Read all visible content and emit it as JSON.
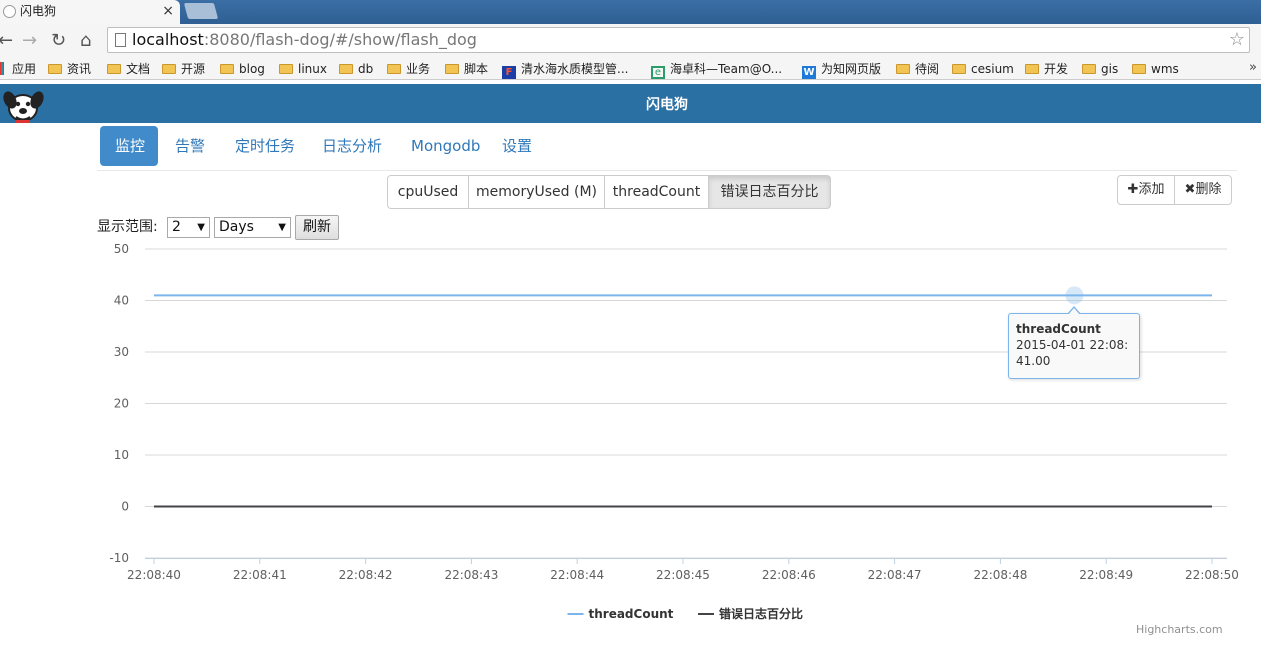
{
  "browser": {
    "tab_title": "闪电狗",
    "tab_close": "×",
    "url_host": "localhost",
    "url_rest": ":8080/flash-dog/#/show/flash_dog",
    "bookmarks": [
      "应用",
      "资讯",
      "文档",
      "开源",
      "blog",
      "linux",
      "db",
      "业务",
      "脚本",
      "清水海水质模型管...",
      "海卓科—Team@O...",
      "为知网页版",
      "待阅",
      "cesium",
      "开发",
      "gis",
      "wms"
    ],
    "more": "»"
  },
  "app": {
    "title": "闪电狗"
  },
  "nav": {
    "tabs": [
      "监控",
      "告警",
      "定时任务",
      "日志分析",
      "Mongodb",
      "设置"
    ],
    "active": "监控"
  },
  "metrics": {
    "buttons": [
      "cpuUsed",
      "memoryUsed (M)",
      "threadCount",
      "错误日志百分比"
    ],
    "active": "错误日志百分比",
    "add_label": "添加",
    "delete_label": "删除"
  },
  "range": {
    "label": "显示范围:",
    "count": "2",
    "unit": "Days",
    "refresh_label": "刷新"
  },
  "chart_data": {
    "type": "line",
    "x": [
      "22:08:40",
      "22:08:41",
      "22:08:42",
      "22:08:43",
      "22:08:44",
      "22:08:45",
      "22:08:46",
      "22:08:47",
      "22:08:48",
      "22:08:49",
      "22:08:50"
    ],
    "series": [
      {
        "name": "threadCount",
        "color": "#7cb5ec",
        "values": [
          41,
          41,
          41,
          41,
          41,
          41,
          41,
          41,
          41,
          41,
          41
        ]
      },
      {
        "name": "错误日志百分比",
        "color": "#434348",
        "values": [
          0,
          0,
          0,
          0,
          0,
          0,
          0,
          0,
          0,
          0,
          0
        ]
      }
    ],
    "yticks": [
      50,
      40,
      30,
      20,
      10,
      0,
      -10
    ],
    "ylim": [
      -10,
      50
    ],
    "grid": true,
    "legend": "bottom-center",
    "tooltip": {
      "series": "threadCount",
      "time": "2015-04-01 22:08:",
      "value": "41.00",
      "x_index": 8.7
    },
    "credits": "Highcharts.com"
  }
}
